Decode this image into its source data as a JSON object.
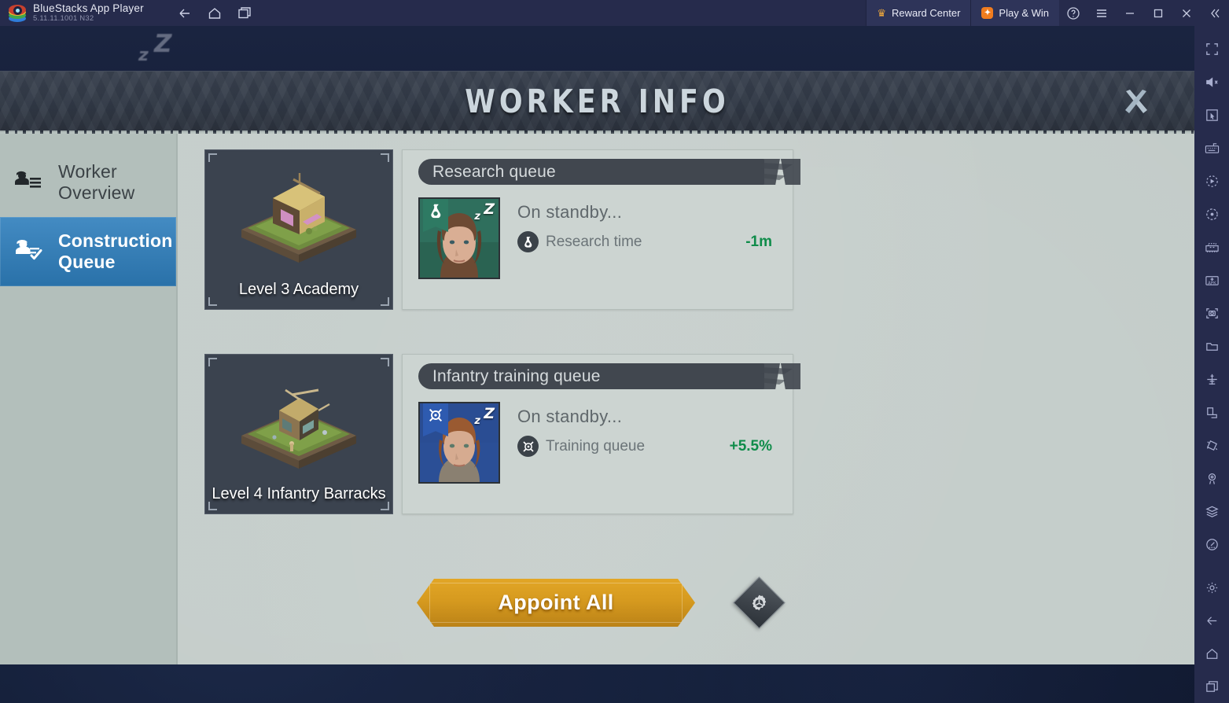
{
  "titlebar": {
    "app_name": "BlueStacks App Player",
    "version": "5.11.11.1001  N32",
    "nav": [
      {
        "name": "back",
        "icon": "back-arrow-icon"
      },
      {
        "name": "home",
        "icon": "home-icon"
      },
      {
        "name": "multi-instance",
        "icon": "instance-manager-icon"
      }
    ],
    "reward_center": "Reward Center",
    "play_and_win": "Play & Win",
    "help": "?",
    "menu": "☰",
    "minimize": "—",
    "maximize": "□",
    "close": "✕",
    "collapse": "«"
  },
  "banner": {
    "title": "WORKER INFO",
    "close_icon": "close-x-icon"
  },
  "sidebar": {
    "items": [
      {
        "label": "Worker Overview",
        "icon": "worker-overview-icon",
        "active": false
      },
      {
        "label": "Construction Queue",
        "icon": "construction-queue-icon",
        "active": true
      }
    ]
  },
  "rows": [
    {
      "building": {
        "name": "Level 3 Academy",
        "art": "academy-building-art"
      },
      "queue": {
        "title": "Research queue",
        "status": "On standby...",
        "stat_label": "Research time",
        "stat_value": "-1m",
        "stat_icon": "research-flask-icon",
        "avatar": {
          "name": "worker-avatar-research",
          "badge_icon": "research-flask-icon",
          "sleep_z_large": "Z",
          "sleep_z_small": "z",
          "bg_color": "#2f6f5d",
          "flag_color": "#2e7a63"
        }
      }
    },
    {
      "building": {
        "name": "Level 4 Infantry Barracks",
        "art": "infantry-barracks-building-art"
      },
      "queue": {
        "title": "Infantry training queue",
        "status": "On standby...",
        "stat_label": "Training queue",
        "stat_value": "+5.5%",
        "stat_icon": "training-spears-icon",
        "avatar": {
          "name": "worker-avatar-training",
          "badge_icon": "training-spears-icon",
          "sleep_z_large": "Z",
          "sleep_z_small": "z",
          "bg_color": "#2a4d93",
          "flag_color": "#2e5bb0"
        }
      }
    }
  ],
  "footer": {
    "appoint_all": "Appoint All",
    "settings_icon": "gear-icon"
  },
  "toolbar": {
    "items": [
      {
        "name": "fullscreen-icon"
      },
      {
        "name": "mute-volume-icon"
      },
      {
        "name": "cursor-pointer-icon"
      },
      {
        "name": "keyboard-controls-icon"
      },
      {
        "name": "macro-record-icon"
      },
      {
        "name": "rotate-sync-icon"
      },
      {
        "name": "multi-instance-sync-icon"
      },
      {
        "name": "install-apk-icon"
      },
      {
        "name": "screenshot-icon"
      },
      {
        "name": "media-folder-icon"
      },
      {
        "name": "airplane-eco-mode-icon"
      },
      {
        "name": "screen-rotate-icon"
      },
      {
        "name": "shake-icon"
      },
      {
        "name": "location-pin-icon"
      },
      {
        "name": "layers-icon"
      },
      {
        "name": "trim-memory-icon"
      },
      {
        "name": "gear-icon"
      },
      {
        "name": "back-arrow-icon"
      },
      {
        "name": "home-icon"
      },
      {
        "name": "recent-apps-icon"
      }
    ]
  },
  "colors": {
    "accent_blue": "#2e7ebc",
    "panel_bg": "#c2cbc8",
    "gold": "#d69a1f",
    "green_stat": "#0f8c4a",
    "titlebar": "#262b4c"
  }
}
